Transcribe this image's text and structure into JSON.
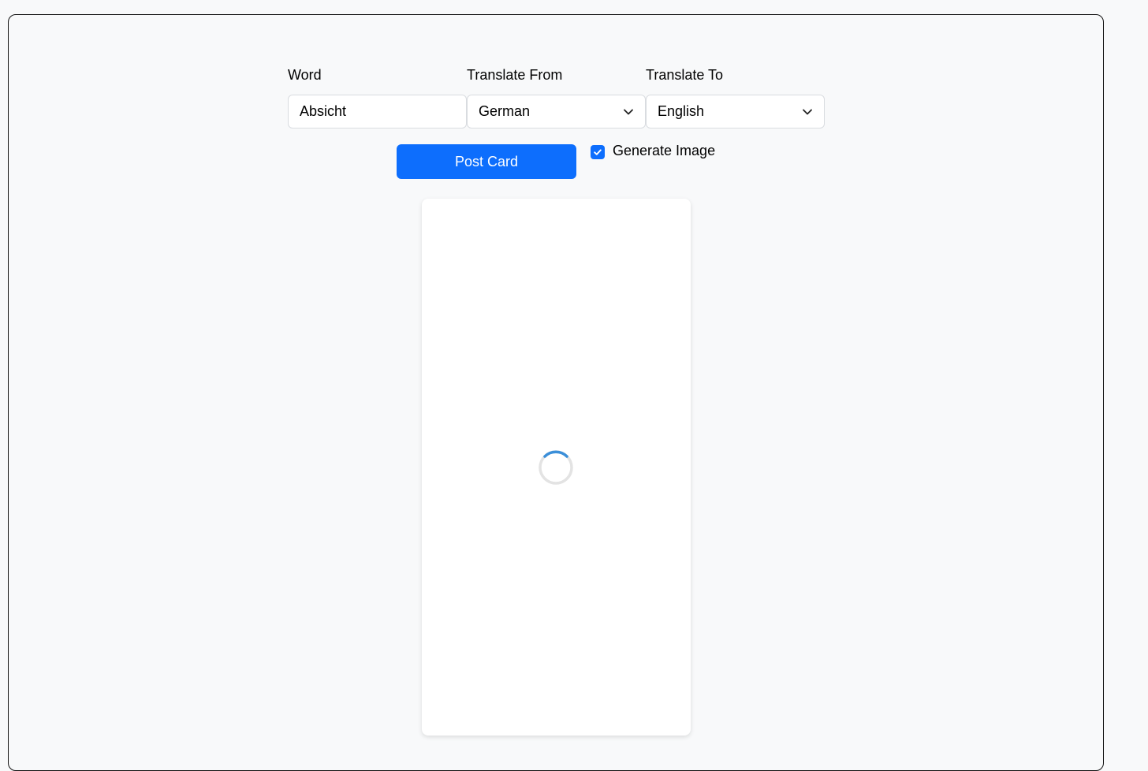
{
  "form": {
    "word_label": "Word",
    "word_value": "Absicht",
    "from_label": "Translate From",
    "from_value": "German",
    "to_label": "Translate To",
    "to_value": "English",
    "post_label": "Post Card",
    "generate_image_label": "Generate Image",
    "generate_image_checked": true
  },
  "card": {
    "state": "loading"
  },
  "colors": {
    "accent": "#0d6efd",
    "spinner": "#3b8fd9",
    "spinner_track": "#e3e3e3"
  },
  "icons": {
    "select_arrow": "chevron-down-icon",
    "checkbox_mark": "check-icon",
    "loader": "spinner-icon"
  }
}
